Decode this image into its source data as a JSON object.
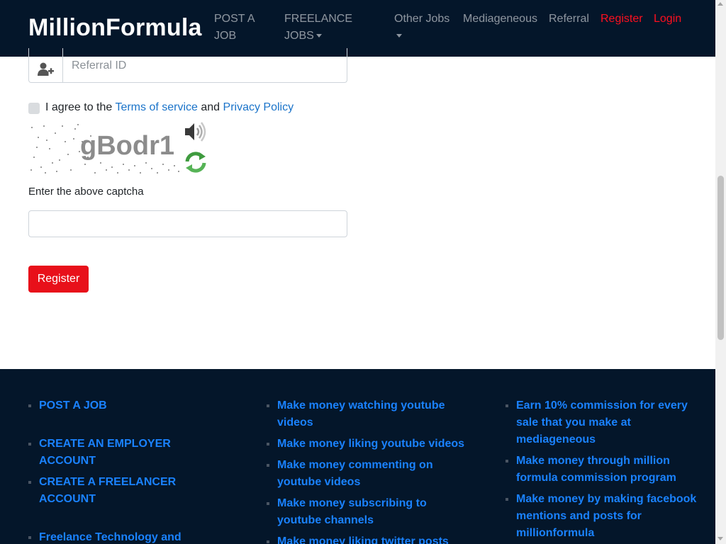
{
  "navbar": {
    "brand": "MillionFormula",
    "items": [
      {
        "label": "POST A",
        "label2": "JOB"
      },
      {
        "label": "FREELANCE",
        "label2": "JOBS"
      },
      {
        "label": "Other Jobs"
      },
      {
        "label": "Mediageneous"
      },
      {
        "label": "Referral"
      },
      {
        "label": "Register"
      },
      {
        "label": "Login"
      }
    ]
  },
  "form": {
    "referral_placeholder": "Referral ID",
    "agree_prefix": "I agree to the",
    "terms_link": "Terms of service",
    "agree_and": "and",
    "privacy_link": "Privacy Policy",
    "captcha_text": "gBodr1",
    "captcha_label": "Enter the above captcha",
    "captcha_value": "",
    "register_button": "Register"
  },
  "footer": {
    "col1": [
      "POST A JOB",
      "CREATE AN EMPLOYER ACCOUNT",
      "CREATE A FREELANCER ACCOUNT",
      "Freelance Technology and"
    ],
    "col2": [
      "Make money watching youtube videos",
      "Make money liking youtube videos",
      "Make money commenting on youtube videos",
      "Make money subscribing to youtube channels",
      "Make money liking twitter posts"
    ],
    "col3": [
      "Earn 10% commission for every sale that you make at mediageneous",
      "Make money through million formula commission program",
      "Make money by making facebook mentions and posts for millionformula"
    ]
  },
  "colors": {
    "navbar_bg": "#04162a",
    "accent_red": "#e8101a",
    "link_blue": "#1a73c9",
    "footer_link": "#1a82ff"
  }
}
